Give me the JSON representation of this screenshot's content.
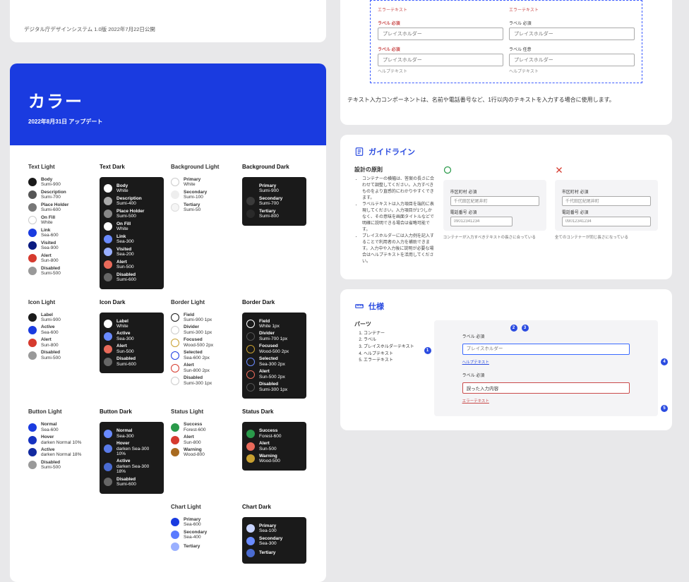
{
  "top_white_caption": "デジタル庁デザインシステム 1.0版 2022年7月22日公開",
  "color": {
    "title": "カラー",
    "subtitle": "2022年8月31日 アップデート",
    "groups": {
      "text_light": {
        "title": "Text Light",
        "items": [
          {
            "name": "Body",
            "sub": "Sumi-900",
            "c": "#1a1a1a"
          },
          {
            "name": "Description",
            "sub": "Sumi-700",
            "c": "#555"
          },
          {
            "name": "Place Holder",
            "sub": "Sumi-600",
            "c": "#777"
          },
          {
            "name": "On Fill",
            "sub": "White",
            "c": "#ffffff",
            "stroke": "#ccc"
          },
          {
            "name": "Link",
            "sub": "Sea-600",
            "c": "#1a3be0"
          },
          {
            "name": "Visited",
            "sub": "Sea-900",
            "c": "#0a1a80"
          },
          {
            "name": "Alert",
            "sub": "Sun-800",
            "c": "#d63a2e"
          },
          {
            "name": "Disabled",
            "sub": "Sumi-500",
            "c": "#999"
          }
        ]
      },
      "text_dark": {
        "title": "Text Dark",
        "items": [
          {
            "name": "Body",
            "sub": "White",
            "c": "#ffffff"
          },
          {
            "name": "Description",
            "sub": "Sumi-400",
            "c": "#aaa"
          },
          {
            "name": "Place Holder",
            "sub": "Sumi-500",
            "c": "#888"
          },
          {
            "name": "On Fill",
            "sub": "White",
            "c": "#ffffff"
          },
          {
            "name": "Link",
            "sub": "Sea-300",
            "c": "#6a8bff"
          },
          {
            "name": "Visited",
            "sub": "Sea-200",
            "c": "#9ab0ff"
          },
          {
            "name": "Alert",
            "sub": "Sun-500",
            "c": "#e86a5a"
          },
          {
            "name": "Disabled",
            "sub": "Sumi-600",
            "c": "#666"
          }
        ]
      },
      "bg_light": {
        "title": "Background Light",
        "items": [
          {
            "name": "Primary",
            "sub": "White",
            "c": "#ffffff",
            "stroke": "#ccc"
          },
          {
            "name": "Secondary",
            "sub": "Sumi-100",
            "c": "#eee"
          },
          {
            "name": "Tertiary",
            "sub": "Sumi-50",
            "c": "#f5f5f5",
            "stroke": "#ddd"
          }
        ]
      },
      "bg_dark": {
        "title": "Background Dark",
        "items": [
          {
            "name": "Primary",
            "sub": "Sumi-900",
            "c": "#1a1a1a"
          },
          {
            "name": "Secondary",
            "sub": "Sumi-700",
            "c": "#3a3a3a"
          },
          {
            "name": "Tertiary",
            "sub": "Sumi-800",
            "c": "#2a2a2a"
          }
        ]
      },
      "border_light": {
        "title": "Border Light",
        "items": [
          {
            "name": "Field",
            "sub": "Sumi-900 1px",
            "c": "#1a1a1a",
            "ring": true
          },
          {
            "name": "Divider",
            "sub": "Sumi-300 1px",
            "c": "#ccc",
            "ring": true
          },
          {
            "name": "Focused",
            "sub": "Wood-500 2px",
            "c": "#c8a030",
            "ring": true
          },
          {
            "name": "Selected",
            "sub": "Sea-600 2px",
            "c": "#1a3be0",
            "ring": true
          },
          {
            "name": "Alert",
            "sub": "Sun-800 2px",
            "c": "#d63a2e",
            "ring": true
          },
          {
            "name": "Disabled",
            "sub": "Sumi-300 1px",
            "c": "#ccc",
            "ring": true
          }
        ]
      },
      "border_dark": {
        "title": "Border Dark",
        "items": [
          {
            "name": "Field",
            "sub": "White 1px",
            "c": "#ffffff",
            "ring": true
          },
          {
            "name": "Divider",
            "sub": "Sumi-700 1px",
            "c": "#555",
            "ring": true
          },
          {
            "name": "Focused",
            "sub": "Wood-500 2px",
            "c": "#c8a030",
            "ring": true
          },
          {
            "name": "Selected",
            "sub": "Sea-300 2px",
            "c": "#6a8bff",
            "ring": true
          },
          {
            "name": "Alert",
            "sub": "Sun-500 2px",
            "c": "#e86a5a",
            "ring": true
          },
          {
            "name": "Disabled",
            "sub": "Sumi-300 1px",
            "c": "#555",
            "ring": true
          }
        ]
      },
      "icon_light": {
        "title": "Icon Light",
        "items": [
          {
            "name": "Label",
            "sub": "Sumi-900",
            "c": "#1a1a1a"
          },
          {
            "name": "Active",
            "sub": "Sea-600",
            "c": "#1a3be0"
          },
          {
            "name": "Alert",
            "sub": "Sun-800",
            "c": "#d63a2e"
          },
          {
            "name": "Disabled",
            "sub": "Sumi-500",
            "c": "#999"
          }
        ]
      },
      "icon_dark": {
        "title": "Icon Dark",
        "items": [
          {
            "name": "Label",
            "sub": "White",
            "c": "#ffffff"
          },
          {
            "name": "Active",
            "sub": "Sea-300",
            "c": "#6a8bff"
          },
          {
            "name": "Alert",
            "sub": "Sun-500",
            "c": "#e86a5a"
          },
          {
            "name": "Disabled",
            "sub": "Sumi-600",
            "c": "#666"
          }
        ]
      },
      "status_light": {
        "title": "Status Light",
        "items": [
          {
            "name": "Success",
            "sub": "Forest-600",
            "c": "#2a9a4a"
          },
          {
            "name": "Alert",
            "sub": "Sun-800",
            "c": "#d63a2e"
          },
          {
            "name": "Warning",
            "sub": "Wood-800",
            "c": "#a86a20"
          }
        ]
      },
      "status_dark": {
        "title": "Status Dark",
        "items": [
          {
            "name": "Success",
            "sub": "Forest-600",
            "c": "#2a9a4a"
          },
          {
            "name": "Alert",
            "sub": "Sun-500",
            "c": "#e86a5a"
          },
          {
            "name": "Warning",
            "sub": "Wood-500",
            "c": "#c8a030"
          }
        ]
      },
      "button_light": {
        "title": "Button Light",
        "items": [
          {
            "name": "Normal",
            "sub": "Sea-600",
            "c": "#1a3be0"
          },
          {
            "name": "Hover",
            "sub": "darken Normal 10%",
            "c": "#1632c0"
          },
          {
            "name": "Active",
            "sub": "darken Normal 18%",
            "c": "#122aa0"
          },
          {
            "name": "Disabled",
            "sub": "Sumi-500",
            "c": "#999"
          }
        ]
      },
      "button_dark": {
        "title": "Button Dark",
        "items": [
          {
            "name": "Normal",
            "sub": "Sea-300",
            "c": "#6a8bff"
          },
          {
            "name": "Hover",
            "sub": "darken Sea-300 10%",
            "c": "#5a7be8"
          },
          {
            "name": "Active",
            "sub": "darken Sea-300 18%",
            "c": "#4a6bd0"
          },
          {
            "name": "Disabled",
            "sub": "Sumi-600",
            "c": "#666"
          }
        ]
      },
      "chart_light": {
        "title": "Chart Light",
        "items": [
          {
            "name": "Primary",
            "sub": "Sea-600",
            "c": "#1a3be0"
          },
          {
            "name": "Secondary",
            "sub": "Sea-400",
            "c": "#5a7bff"
          },
          {
            "name": "Tertiary",
            "sub": "",
            "c": "#9ab0ff"
          }
        ]
      },
      "chart_dark": {
        "title": "Chart Dark",
        "items": [
          {
            "name": "Primary",
            "sub": "Sea-100",
            "c": "#c8d4ff"
          },
          {
            "name": "Secondary",
            "sub": "Sea-300",
            "c": "#6a8bff"
          },
          {
            "name": "Tertiary",
            "sub": "",
            "c": "#4a6bd0"
          }
        ]
      }
    }
  },
  "right": {
    "top_form": {
      "err": "エラーテキスト",
      "label_req": "ラベル 必須",
      "label_opt": "ラベル 任意",
      "placeholder": "プレイスホルダー",
      "help": "ヘルプテキスト"
    },
    "desc_text": "テキスト入力コンポーネントは、名前や電話番号など、1行以内のテキストを入力する場合に使用します。",
    "guideline": {
      "title": "ガイドライン",
      "principle_title": "設計の原則",
      "bullets": [
        "コンテナーの横幅は、答案の長さに合わせて調整してください。入力すべきものをより直感的にわかりやすくできます。",
        "ラベルテキストは入力項目を端的に表現してください。入力項目が1つしかなく、その意味を画面タイトルなどで明確に説明できる場合は省略可能です。",
        "プレイスホルダーには入力例を記入することで利用者の入力を補助できます。入力中や入力後に説明が必要な場合はヘルプテキストを活用してください。"
      ],
      "good": {
        "city_label": "市区町村 必須",
        "city_val": "千代田区紀尾井町",
        "tel_label": "電話番号 必須",
        "tel_val": "09012341234",
        "cap": "コンテナーが入力すべきテキストの長さに合っている"
      },
      "bad": {
        "city_label": "市区町村 必須",
        "city_val": "千代田区紀尾井町",
        "tel_label": "電話番号 必須",
        "tel_val": "09012341234",
        "cap": "全てのコンテナーが同じ長さになっている"
      }
    },
    "spec": {
      "title": "仕様",
      "parts_title": "パーツ",
      "parts": [
        "コンテナー",
        "ラベル",
        "プレイスホルダーテキスト",
        "ヘルプテキスト",
        "エラーテキスト"
      ],
      "preview": {
        "label": "ラベル 必須",
        "placeholder": "プレイスホルダー",
        "help": "ヘルプテキスト",
        "label2": "ラベル 必須",
        "err_val": "誤った入力内容",
        "err_txt": "エラーテキスト"
      }
    }
  }
}
